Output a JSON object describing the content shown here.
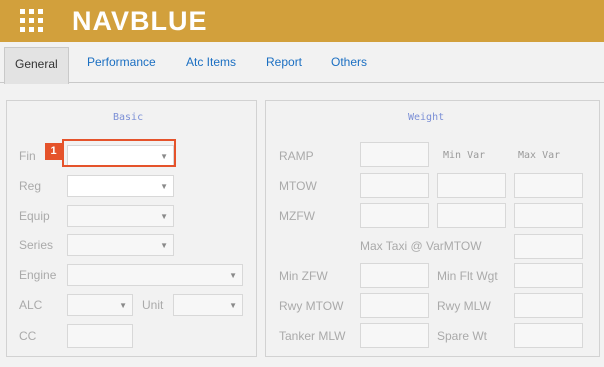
{
  "app": {
    "brand": "NAVBLUE"
  },
  "tabs": [
    {
      "label": "General"
    },
    {
      "label": "Performance"
    },
    {
      "label": "Atc Items"
    },
    {
      "label": "Report"
    },
    {
      "label": "Others"
    }
  ],
  "basic": {
    "title": "Basic",
    "fin_label": "Fin",
    "reg_label": "Reg",
    "equip_label": "Equip",
    "series_label": "Series",
    "engine_label": "Engine",
    "alc_label": "ALC",
    "unit_label": "Unit",
    "cc_label": "CC"
  },
  "weight": {
    "title": "Weight",
    "min_var_header": "Min Var",
    "max_var_header": "Max Var",
    "ramp_label": "RAMP",
    "mtow_label": "MTOW",
    "mzfw_label": "MZFW",
    "max_taxi_label": "Max Taxi @ VarMTOW",
    "min_zfw_label": "Min ZFW",
    "min_flt_wgt_label": "Min Flt Wgt",
    "rwy_mtow_label": "Rwy MTOW",
    "rwy_mlw_label": "Rwy MLW",
    "tanker_mlw_label": "Tanker MLW",
    "spare_wt_label": "Spare Wt"
  },
  "annotation": {
    "badge": "1"
  },
  "colors": {
    "header": "#d2a03c",
    "link": "#1b6fc2",
    "highlight": "#e5532b"
  }
}
